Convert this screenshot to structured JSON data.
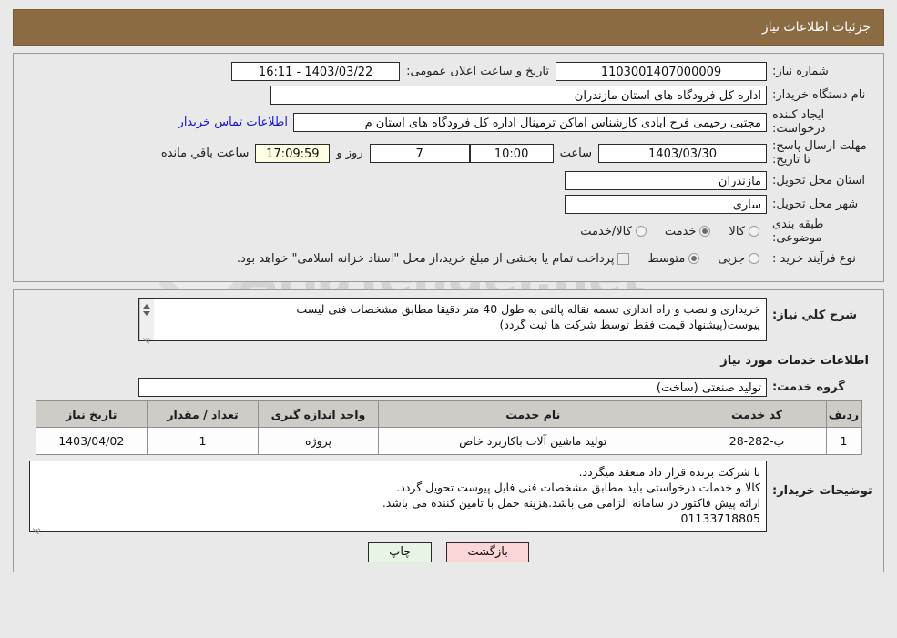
{
  "header": {
    "title": "جزئیات اطلاعات نیاز"
  },
  "form": {
    "need_number_label": "شماره نیاز:",
    "need_number_value": "1103001407000009",
    "announce_label": "تاریخ و ساعت اعلان عمومی:",
    "announce_value": "1403/03/22 - 16:11",
    "buyer_org_label": "نام دستگاه خریدار:",
    "buyer_org_value": "اداره کل فرودگاه های استان مازندران",
    "creator_label": "ایجاد کننده درخواست:",
    "creator_value": "مجتبی رحیمی فرح آبادی کارشناس اماکن ترمینال اداره کل فرودگاه های استان م",
    "contact_link": "اطلاعات تماس خریدار",
    "deadline_label": "مهلت ارسال پاسخ: تا تاریخ:",
    "deadline_date": "1403/03/30",
    "deadline_time_label": "ساعت",
    "deadline_time": "10:00",
    "days_value": "7",
    "days_label": "روز و",
    "remaining_clock": "17:09:59",
    "remaining_label": "ساعت باقي مانده",
    "province_label": "استان محل تحویل:",
    "province_value": "مازندران",
    "city_label": "شهر محل تحویل:",
    "city_value": "ساری",
    "category_label": "طبقه بندی موضوعی:",
    "category_options": [
      {
        "label": "کالا",
        "selected": false
      },
      {
        "label": "خدمت",
        "selected": true
      },
      {
        "label": "کالا/خدمت",
        "selected": false
      }
    ],
    "process_label": "نوع فرآیند خرید :",
    "process_options": [
      {
        "label": "جزیی",
        "selected": false
      },
      {
        "label": "متوسط",
        "selected": true
      }
    ],
    "treasury_checkbox_label": "پرداخت تمام یا بخشی از مبلغ خرید،از محل \"اسناد خزانه اسلامی\" خواهد بود.",
    "treasury_checked": false
  },
  "description": {
    "label": "شرح کلي نياز:",
    "lines": [
      "خریداری و نصب و راه اندازی تسمه نقاله پالتی به طول 40 متر دقیقا مطابق مشخصات فنی لیست",
      "پیوست(پیشنهاد قیمت فقط توسط شرکت ها ثبت گردد)"
    ]
  },
  "services": {
    "section_title": "اطلاعات خدمات مورد نیاز",
    "group_label": "گروه خدمت:",
    "group_value": "تولید صنعتی (ساخت)",
    "columns": [
      "ردیف",
      "کد خدمت",
      "نام خدمت",
      "واحد اندازه گیری",
      "تعداد / مقدار",
      "تاریخ نیاز"
    ],
    "rows": [
      {
        "radif": "1",
        "code": "ب-282-28",
        "name": "تولید ماشین آلات باکاربرد خاص",
        "unit": "پروژه",
        "qty": "1",
        "date": "1403/04/02"
      }
    ]
  },
  "notes": {
    "label": "توضیحات خریدار:",
    "lines": [
      "با شرکت برنده قرار داد منعقد میگردد.",
      "کالا و خدمات درخواستی باید مطابق مشخصات فنی فایل پیوست تحویل گردد.",
      "ارائه پیش فاکتور در سامانه الزامی می باشد.هزینه حمل با تامین کننده می باشد.",
      "01133718805"
    ]
  },
  "footer": {
    "print_label": "چاپ",
    "back_label": "بازگشت"
  },
  "watermark": {
    "text": "AriaTender.net"
  },
  "colors": {
    "header_bg": "#8a6b42",
    "link": "#1515cf",
    "print_btn": "#e7f6e4",
    "back_btn": "#fbd6d6",
    "table_header": "#cfcbc7"
  }
}
